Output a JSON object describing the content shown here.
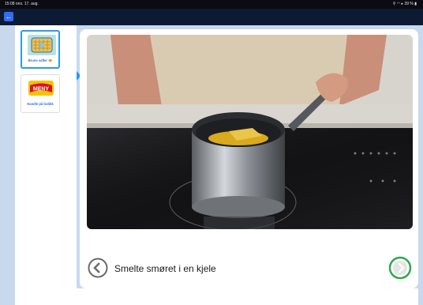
{
  "statusbar": {
    "time": "15:08 ons. 17. aug.",
    "right": "⚲ ◠ ▸ 39 % ▮"
  },
  "nav": {
    "back_icon": "arrow-left-icon"
  },
  "sidebar": {
    "items": [
      {
        "label": "Brune vafler 🧇",
        "active": true,
        "icon": "waffle-recipe-thumbnail"
      },
      {
        "label": "Handle på butikk",
        "active": false,
        "icon": "meny-logo"
      }
    ],
    "meny_logo_text": "MENY"
  },
  "step": {
    "caption": "Smelte smøret i en kjele",
    "prev_icon": "chevron-left-icon",
    "next_icon": "chevron-right-icon"
  },
  "colors": {
    "accent_blue": "#2f6df3",
    "next_green": "#2fa84f",
    "bg": "#c8d9ee"
  }
}
